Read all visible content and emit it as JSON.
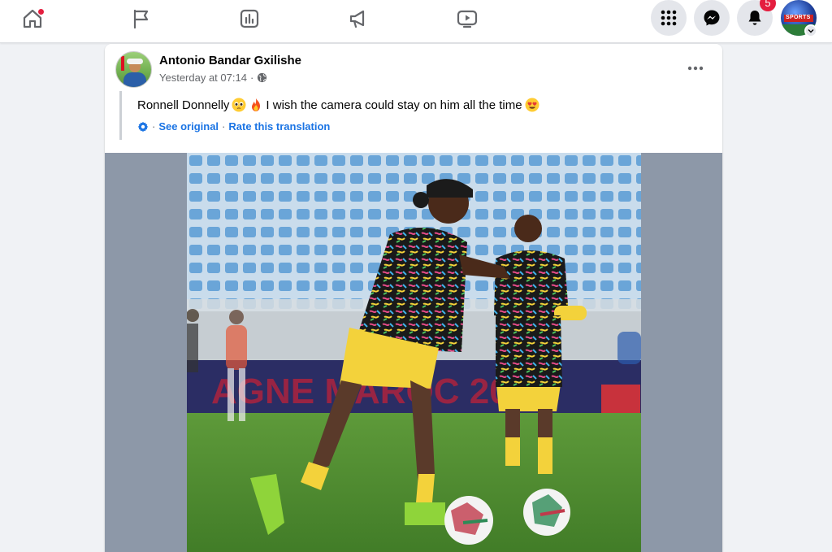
{
  "nav": {
    "icons": [
      "home-icon",
      "flag-icon",
      "chart-icon",
      "megaphone-icon",
      "video-icon"
    ],
    "home_has_dot": true
  },
  "topright": {
    "menu_icon": "grid-menu-icon",
    "messenger_icon": "messenger-icon",
    "notifications_icon": "bell-icon",
    "notifications_count": "5",
    "profile_label": "SPORTS"
  },
  "post": {
    "author": "Antonio Bandar Gxilishe",
    "timestamp": "Yesterday at 07:14",
    "separator": "·",
    "privacy_icon": "globe-icon",
    "text_name": "Ronnell Donnelly",
    "text_body": "I wish the camera could stay on him all the time",
    "emoji_1": "pleading-face",
    "emoji_2": "fire",
    "emoji_3": "heart-eyes",
    "translation": {
      "see_original": "See original",
      "separator": "·",
      "rate": "Rate this translation"
    },
    "banner_text": "AGNE MAROC 2024"
  },
  "colors": {
    "accent": "#1b74e4",
    "badge": "#e41e3f",
    "text": "#050505",
    "muted": "#65676b"
  }
}
